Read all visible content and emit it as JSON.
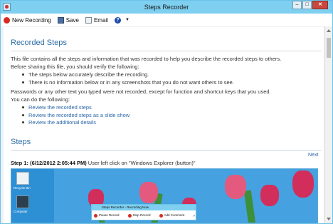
{
  "window": {
    "title": "Steps Recorder",
    "buttons": [
      "–",
      "□",
      "✕"
    ]
  },
  "toolbar": {
    "new_recording": "New Recording",
    "save": "Save",
    "email": "Email",
    "help": "?",
    "help_dropdown": "▼"
  },
  "recorded_steps": {
    "heading": "Recorded Steps",
    "intro_1": "This file contains all the steps and information that was recorded to help you describe the recorded steps to others.",
    "intro_2": "Before sharing this file, you should verify the following:",
    "checks": [
      "The steps below accurately describe the recording.",
      "There is no information below or in any screenshots that you do not want others to see."
    ],
    "passwords_note": "Passwords or any other text you typed were not recorded, except for function and shortcut keys that you used.",
    "can_do": "You can do the following:",
    "links": [
      "Review the recorded steps",
      "Review the recorded steps as a slide show",
      "Review the additional details"
    ]
  },
  "steps": {
    "heading": "Steps",
    "next_link": "Next",
    "step1_label": "Step 1: (6/12/2012 2:05:44 PM)",
    "step1_text": " User left click on \"Windows Explorer (button)\""
  },
  "screenshot": {
    "desktop_icons": [
      "Recycle Bin",
      "Computer"
    ],
    "mini_recorder_title": "Steps Recorder - Recording Now",
    "mini_tools": [
      "Pause Record",
      "Stop Record",
      "Add Comment",
      "?"
    ]
  },
  "colors": {
    "titlebar": "#7ecff0",
    "heading": "#2f6ea6",
    "link": "#2b67a8",
    "record": "#d62b22"
  }
}
